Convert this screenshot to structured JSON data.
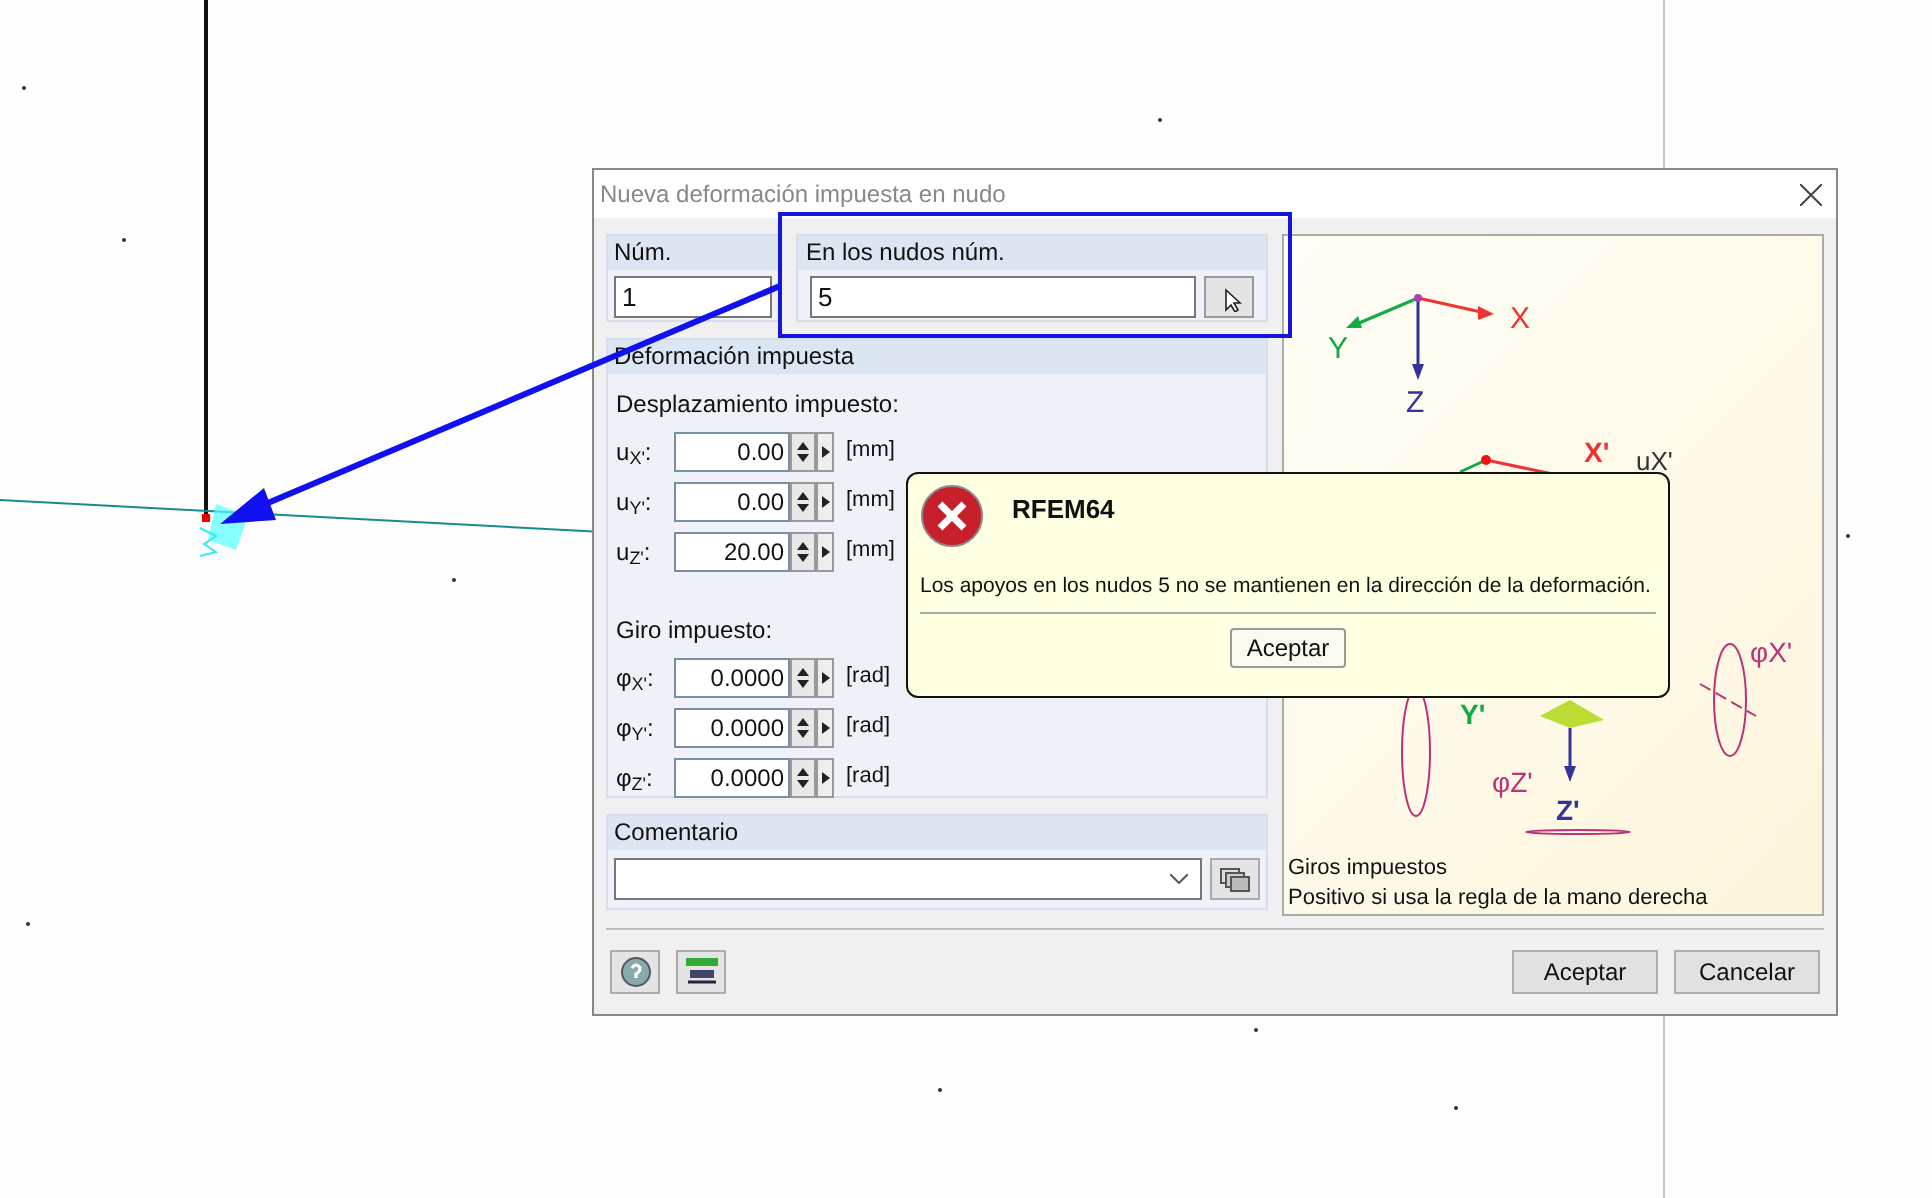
{
  "dialog": {
    "title": "Nueva deformación impuesta en nudo"
  },
  "num": {
    "label": "Núm.",
    "value": "1"
  },
  "nodes": {
    "label": "En los nudos núm.",
    "value": "5"
  },
  "deformation": {
    "title": "Deformación impuesta",
    "displacement_title": "Desplazamiento impuesto:",
    "displacements": [
      {
        "label": "u$_{X'}$:",
        "value": "0.00",
        "unit": "[mm]"
      },
      {
        "label": "u$_{Y'}$:",
        "value": "0.00",
        "unit": "[mm]"
      },
      {
        "label": "u$_{Z'}$:",
        "value": "20.00",
        "unit": "[mm]"
      }
    ],
    "rotation_title": "Giro impuesto:",
    "rotations": [
      {
        "label": "φ$_{X'}$:",
        "value": "0.0000",
        "unit": "[rad]"
      },
      {
        "label": "φ$_{Y'}$:",
        "value": "0.0000",
        "unit": "[rad]"
      },
      {
        "label": "φ$_{Z'}$:",
        "value": "0.0000",
        "unit": "[rad]"
      }
    ]
  },
  "comment": {
    "label": "Comentario"
  },
  "diagram": {
    "labels": [
      "X",
      "Y",
      "Z",
      "X'",
      "uX'",
      "φX'",
      "Y'",
      "φZ'",
      "Z'"
    ],
    "caption_title": "Giros impuestos",
    "caption_text": "Positivo si usa la regla de la mano derecha"
  },
  "buttons": [
    {
      "label": "Aceptar"
    },
    {
      "label": "Cancelar"
    }
  ],
  "message": {
    "title": "RFEM64",
    "text": "Los apoyos en los nudos 5 no se mantienen en la dirección de la deformación.",
    "button": "Aceptar"
  }
}
